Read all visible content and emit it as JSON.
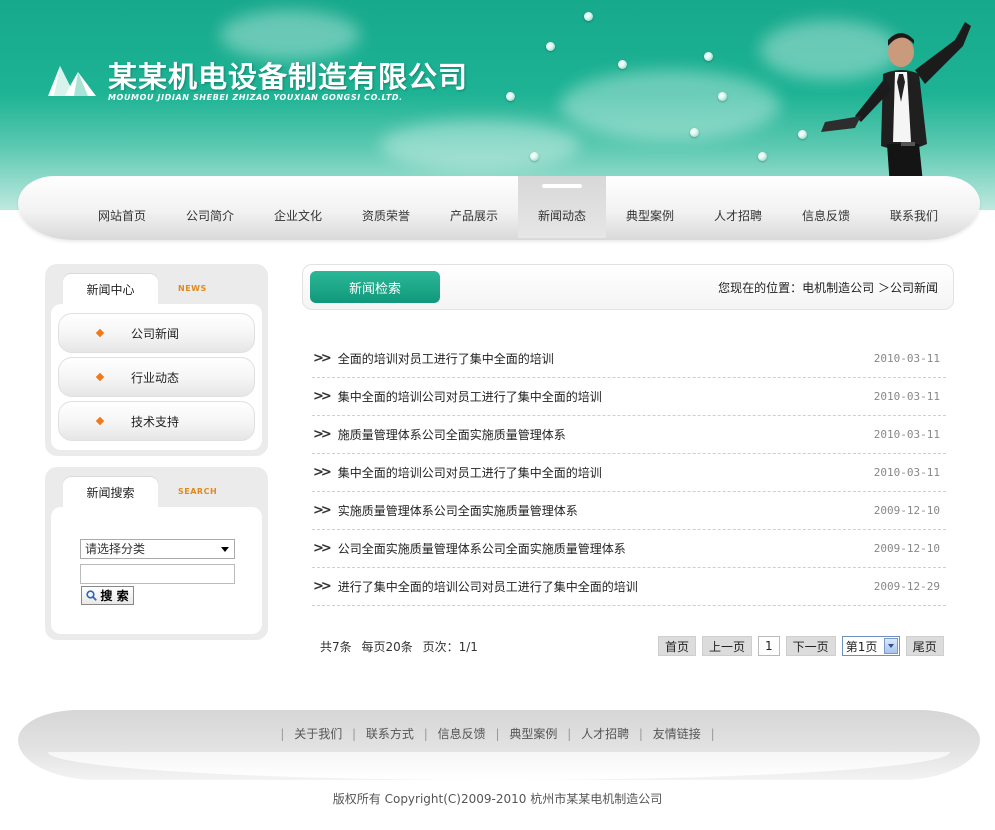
{
  "header": {
    "company_name": "某某机电设备制造有限公司",
    "company_name_en": "MOUMOU JIDIAN SHEBEI ZHIZAO YOUXIAN GONGSI CO.LTD."
  },
  "nav": {
    "items": [
      {
        "label": "网站首页"
      },
      {
        "label": "公司简介"
      },
      {
        "label": "企业文化"
      },
      {
        "label": "资质荣誉"
      },
      {
        "label": "产品展示"
      },
      {
        "label": "新闻动态"
      },
      {
        "label": "典型案例"
      },
      {
        "label": "人才招聘"
      },
      {
        "label": "信息反馈"
      },
      {
        "label": "联系我们"
      }
    ],
    "active": "新闻动态"
  },
  "sidebar": {
    "news_center": {
      "title": "新闻中心",
      "title_en": "NEWS",
      "items": [
        {
          "label": "公司新闻"
        },
        {
          "label": "行业动态"
        },
        {
          "label": "技术支持"
        }
      ]
    },
    "news_search": {
      "title": "新闻搜索",
      "title_en": "SEARCH",
      "select_value": "请选择分类",
      "input_value": "",
      "button_label": "搜 索"
    }
  },
  "main": {
    "section_title": "新闻检索",
    "location": "您现在的位置：电机制造公司 ＞公司新闻",
    "news": [
      {
        "title": "全面的培训对员工进行了集中全面的培训",
        "date": "2010-03-11"
      },
      {
        "title": "集中全面的培训公司对员工进行了集中全面的培训",
        "date": "2010-03-11"
      },
      {
        "title": "施质量管理体系公司全面实施质量管理体系",
        "date": "2010-03-11"
      },
      {
        "title": "集中全面的培训公司对员工进行了集中全面的培训",
        "date": "2010-03-11"
      },
      {
        "title": "实施质量管理体系公司全面实施质量管理体系",
        "date": "2009-12-10"
      },
      {
        "title": "公司全面实施质量管理体系公司全面实施质量管理体系",
        "date": "2009-12-10"
      },
      {
        "title": "进行了集中全面的培训公司对员工进行了集中全面的培训",
        "date": "2009-12-29"
      }
    ],
    "pagination": {
      "total": "共7条",
      "per_page": "每页20条",
      "page_info": "页次：1/1",
      "first": "首页",
      "prev": "上一页",
      "current": "1",
      "next": "下一页",
      "page_select": "第1页",
      "last": "尾页"
    }
  },
  "footer": {
    "links": [
      {
        "label": "关于我们"
      },
      {
        "label": "联系方式"
      },
      {
        "label": "信息反馈"
      },
      {
        "label": "典型案例"
      },
      {
        "label": "人才招聘"
      },
      {
        "label": "友情链接"
      }
    ],
    "copyright": "版权所有  Copyright(C)2009-2010 杭州市某某电机制造公司"
  },
  "colors": {
    "brand_green": "#17a98c",
    "accent_orange": "#f07a1a"
  }
}
